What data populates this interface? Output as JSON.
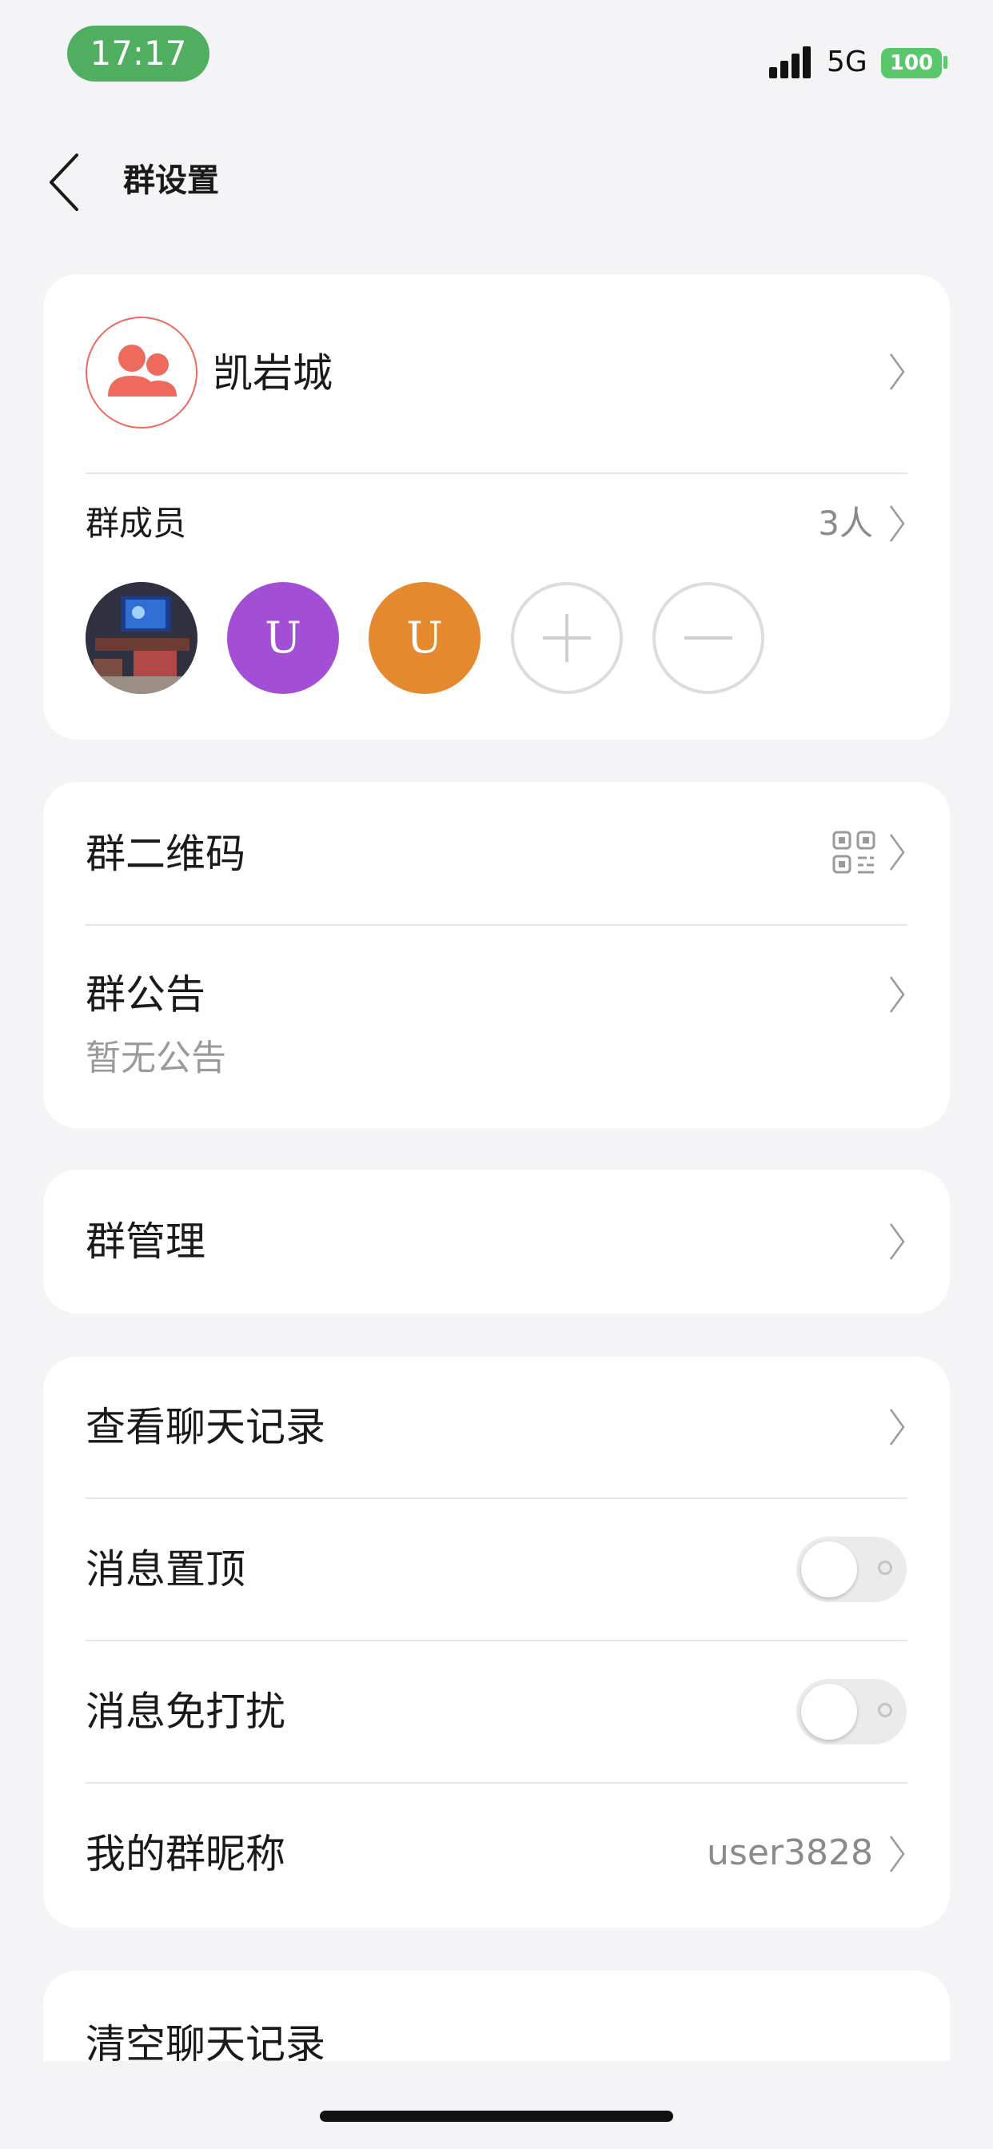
{
  "status_bar": {
    "time": "17:17",
    "network": "5G",
    "battery": "100"
  },
  "nav": {
    "title": "群设置"
  },
  "group": {
    "name": "凯岩城"
  },
  "members": {
    "label": "群成员",
    "count": "3人",
    "avatars": [
      {
        "kind": "photo"
      },
      {
        "kind": "initial",
        "letter": "U",
        "color": "#a24fd6"
      },
      {
        "kind": "initial",
        "letter": "U",
        "color": "#e5892e"
      }
    ]
  },
  "qr": {
    "label": "群二维码"
  },
  "notice": {
    "label": "群公告",
    "empty_text": "暂无公告"
  },
  "manage": {
    "label": "群管理"
  },
  "history": {
    "label": "查看聊天记录"
  },
  "pin": {
    "label": "消息置顶",
    "on": false
  },
  "mute": {
    "label": "消息免打扰",
    "on": false
  },
  "nickname": {
    "label": "我的群昵称",
    "value": "user3828"
  },
  "clear": {
    "label": "清空聊天记录"
  },
  "colors": {
    "accent": "#ee6a5d",
    "time_pill": "#4fae5f",
    "battery": "#58c86a"
  }
}
